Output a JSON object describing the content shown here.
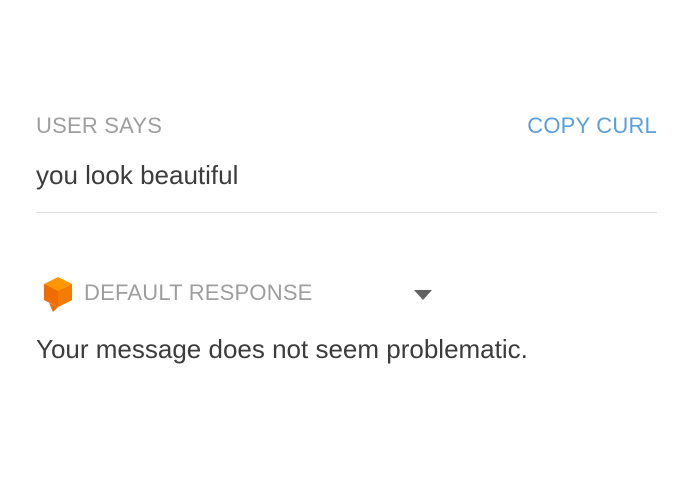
{
  "request": {
    "label": "USER SAYS",
    "copy_curl_label": "COPY CURL",
    "query": "you look beautiful"
  },
  "response": {
    "icon": "dialogflow-agent-icon",
    "label": "DEFAULT RESPONSE",
    "text": "Your message does not seem problematic."
  },
  "colors": {
    "accent_link": "#5c9fd8",
    "muted_text": "#9e9e9e",
    "body_text": "#3c3c3c",
    "icon_orange": "#f57c00",
    "icon_orange_light": "#ff9800"
  }
}
